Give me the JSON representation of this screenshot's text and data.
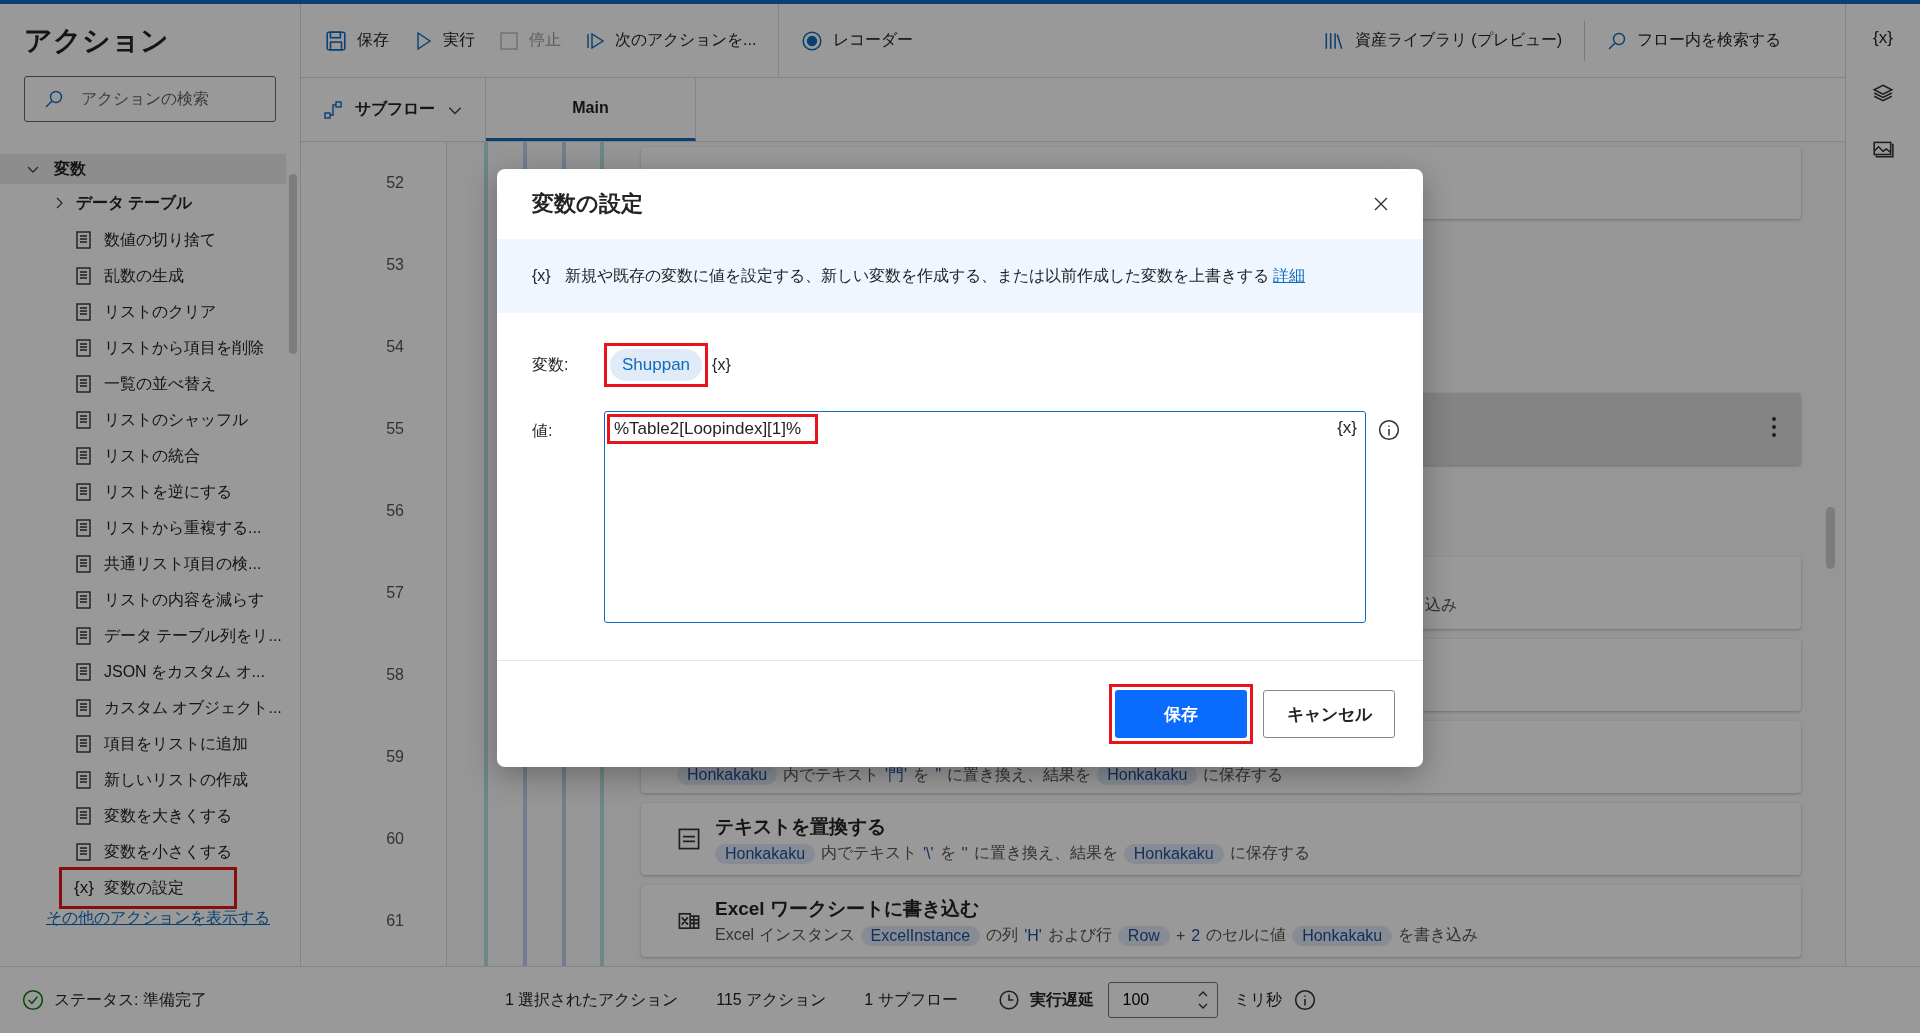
{
  "sidebar": {
    "title": "アクション",
    "search": {
      "placeholder": "アクションの検索"
    },
    "tree": [
      {
        "label": "変数",
        "expanded": true,
        "children": [
          {
            "kind": "folder",
            "label": "データ テーブル",
            "expanded": false
          },
          {
            "kind": "action",
            "label": "数値の切り捨て"
          },
          {
            "kind": "action",
            "label": "乱数の生成"
          },
          {
            "kind": "action",
            "label": "リストのクリア"
          },
          {
            "kind": "action",
            "label": "リストから項目を削除"
          },
          {
            "kind": "action",
            "label": "一覧の並べ替え"
          },
          {
            "kind": "action",
            "label": "リストのシャッフル"
          },
          {
            "kind": "action",
            "label": "リストの統合"
          },
          {
            "kind": "action",
            "label": "リストを逆にする"
          },
          {
            "kind": "action",
            "label": "リストから重複する..."
          },
          {
            "kind": "action",
            "label": "共通リスト項目の検..."
          },
          {
            "kind": "action",
            "label": "リストの内容を減らす"
          },
          {
            "kind": "action",
            "label": "データ テーブル列をリ..."
          },
          {
            "kind": "action",
            "label": "JSON をカスタム オ..."
          },
          {
            "kind": "action",
            "label": "カスタム オブジェクト..."
          },
          {
            "kind": "action",
            "label": "項目をリストに追加"
          },
          {
            "kind": "action",
            "label": "新しいリストの作成"
          },
          {
            "kind": "action",
            "label": "変数を大きくする"
          },
          {
            "kind": "action",
            "label": "変数を小さくする"
          },
          {
            "kind": "action",
            "label": "変数の設定",
            "glyph": "{x}",
            "annotated": true
          }
        ]
      }
    ],
    "more_link": "その他のアクションを表示する"
  },
  "toolbar": {
    "items": [
      {
        "kind": "save",
        "label": "保存",
        "disabled": false
      },
      {
        "kind": "run",
        "label": "実行",
        "disabled": false
      },
      {
        "kind": "stop",
        "label": "停止",
        "disabled": true
      },
      {
        "kind": "step",
        "label": "次のアクションを..."
      },
      {
        "kind": "record",
        "label": "レコーダー"
      }
    ],
    "library": "資産ライブラリ (プレビュー)",
    "search": "フロー内を検索する"
  },
  "subflows": {
    "menu": "サブフロー",
    "tabs": [
      {
        "label": "Main",
        "selected": true
      }
    ]
  },
  "right_rail": {
    "glyph": "{x}"
  },
  "flow": {
    "rows": [
      {
        "number": "52",
        "card": true,
        "selected": false
      },
      {
        "number": "53",
        "card": false
      },
      {
        "number": "54",
        "card": false
      },
      {
        "number": "55",
        "card": true,
        "selected": true
      },
      {
        "number": "56",
        "card": false
      },
      {
        "number": "57",
        "card": true,
        "selected": false,
        "tail": "込み"
      },
      {
        "number": "58",
        "card": true,
        "selected": false
      },
      {
        "number": "59",
        "card": true,
        "selected": false,
        "description": [
          {
            "kind": "var",
            "text": "Honkakaku"
          },
          {
            "kind": "plain",
            "text": "内でテキスト"
          },
          {
            "kind": "literal",
            "text": "'門'"
          },
          {
            "kind": "plain",
            "text": "を"
          },
          {
            "kind": "literal",
            "text": "''"
          },
          {
            "kind": "plain",
            "text": "に置き換え、結果を"
          },
          {
            "kind": "var",
            "text": "Honkakaku"
          },
          {
            "kind": "plain",
            "text": "に保存する"
          }
        ]
      },
      {
        "number": "60",
        "card": true,
        "selected": false,
        "kind": "text",
        "title": "テキストを置換する",
        "description": [
          {
            "kind": "var",
            "text": "Honkakaku"
          },
          {
            "kind": "plain",
            "text": "内でテキスト"
          },
          {
            "kind": "literal",
            "text": "'\\'"
          },
          {
            "kind": "plain",
            "text": "を"
          },
          {
            "kind": "literal",
            "text": "''"
          },
          {
            "kind": "plain",
            "text": "に置き換え、結果を"
          },
          {
            "kind": "var",
            "text": "Honkakaku"
          },
          {
            "kind": "plain",
            "text": "に保存する"
          }
        ]
      },
      {
        "number": "61",
        "card": true,
        "selected": false,
        "kind": "excel",
        "title": "Excel ワークシートに書き込む",
        "description": [
          {
            "kind": "plain",
            "text": "Excel インスタンス"
          },
          {
            "kind": "var",
            "text": "ExcelInstance"
          },
          {
            "kind": "plain",
            "text": "の列"
          },
          {
            "kind": "literal",
            "text": "'H'"
          },
          {
            "kind": "plain",
            "text": "および行"
          },
          {
            "kind": "var",
            "text": "Row"
          },
          {
            "kind": "plain",
            "text": "+"
          },
          {
            "kind": "literal",
            "text": "2"
          },
          {
            "kind": "plain",
            "text": "のセルに値"
          },
          {
            "kind": "var",
            "text": "Honkakaku"
          },
          {
            "kind": "plain",
            "text": "を書き込み"
          }
        ]
      }
    ]
  },
  "dialog": {
    "title": "変数の設定",
    "info_glyph": "{x}",
    "info": "新規や既存の変数に値を設定する、新しい変数を作成する、または以前作成した変数を上書きする",
    "info_link": "詳細",
    "variable": {
      "label": "変数:",
      "name": "Shuppan",
      "annotated": true,
      "glyph": "{x}"
    },
    "value": {
      "label": "値:",
      "text": "%Table2[Loopindex][1]%",
      "annotated": true,
      "glyph": "{x}"
    },
    "buttons": [
      {
        "kind": "primary",
        "label": "保存",
        "annotated": true
      },
      {
        "kind": "secondary",
        "label": "キャンセル"
      }
    ]
  },
  "status_bar": {
    "status": "ステータス: 準備完了",
    "counts": [
      "1 選択されたアクション",
      "115 アクション",
      "1 サブフロー"
    ],
    "delay_label": "実行遅延",
    "delay_value": "100",
    "unit": "ミリ秒"
  }
}
